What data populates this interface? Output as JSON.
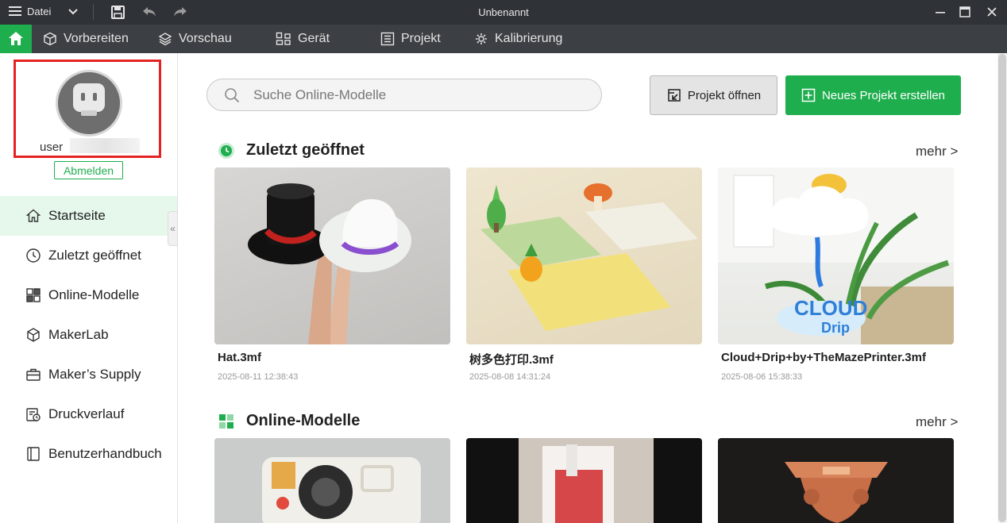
{
  "window": {
    "title": "Unbenannt"
  },
  "titlebar": {
    "menu_label": "Datei"
  },
  "nav": {
    "items": [
      {
        "label": "Vorbereiten",
        "icon": "cube-icon"
      },
      {
        "label": "Vorschau",
        "icon": "layers-icon"
      },
      {
        "label": "Gerät",
        "icon": "device-icon"
      },
      {
        "label": "Projekt",
        "icon": "project-icon"
      },
      {
        "label": "Kalibrierung",
        "icon": "calibration-icon"
      }
    ]
  },
  "user": {
    "name": "user",
    "logout_label": "Abmelden"
  },
  "sidebar": {
    "items": [
      {
        "label": "Startseite",
        "icon": "home-icon",
        "active": true
      },
      {
        "label": "Zuletzt geöffnet",
        "icon": "clock-icon"
      },
      {
        "label": "Online-Modelle",
        "icon": "models-icon"
      },
      {
        "label": "MakerLab",
        "icon": "makerlab-icon"
      },
      {
        "label": "Maker’s Supply",
        "icon": "supply-icon"
      },
      {
        "label": "Druckverlauf",
        "icon": "print-history-icon"
      },
      {
        "label": "Benutzerhandbuch",
        "icon": "manual-icon"
      }
    ]
  },
  "search": {
    "placeholder": "Suche Online-Modelle"
  },
  "actions": {
    "open_label": "Projekt öffnen",
    "new_label": "Neues Projekt erstellen"
  },
  "recent": {
    "title": "Zuletzt geöffnet",
    "more": "mehr >",
    "cards": [
      {
        "name": "Hat.3mf",
        "date": "2025-08-11 12:38:43"
      },
      {
        "name": "树多色打印.3mf",
        "date": "2025-08-08 14:31:24"
      },
      {
        "name": "Cloud+Drip+by+TheMazePrinter.3mf",
        "date": "2025-08-06 15:38:33"
      }
    ]
  },
  "online": {
    "title": "Online-Modelle",
    "more": "mehr >"
  },
  "colors": {
    "accent": "#1fae4e",
    "highlight": "#e52222",
    "titlebar": "#2f3236",
    "navbar": "#3c3f43"
  }
}
